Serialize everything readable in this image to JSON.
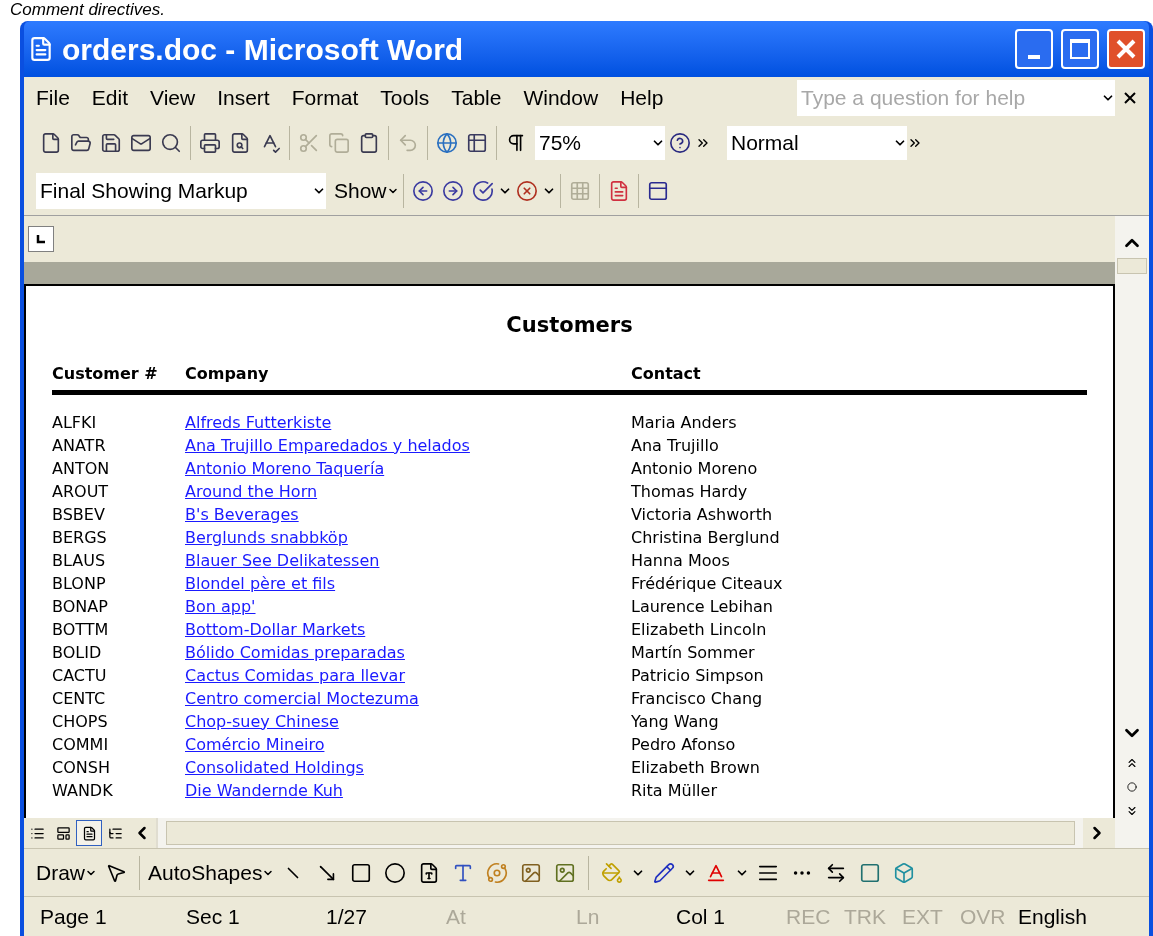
{
  "caption": "Comment directives.",
  "window": {
    "title": "orders.doc - Microsoft Word"
  },
  "menu": [
    "File",
    "Edit",
    "View",
    "Insert",
    "Format",
    "Tools",
    "Table",
    "Window",
    "Help"
  ],
  "help_box": {
    "placeholder": "Type a question for help"
  },
  "standard_toolbar": [
    {
      "disabled": false
    },
    {
      "disabled": false
    },
    {
      "disabled": false
    },
    {
      "disabled": false
    },
    {
      "disabled": false
    },
    {
      "disabled": false
    },
    {
      "disabled": false
    },
    {
      "disabled": false
    },
    {
      "disabled": true
    },
    {
      "disabled": true
    },
    {
      "disabled": false
    },
    {
      "disabled": true
    }
  ],
  "zoom": "75%",
  "style": "Normal",
  "display_mode": "Final Showing Markup",
  "show_menu": "Show",
  "document": {
    "heading": "Customers",
    "columns": [
      "Customer #",
      "Company",
      "Contact"
    ],
    "rows": [
      {
        "id": "ALFKI",
        "company": "Alfreds Futterkiste",
        "contact": "Maria Anders"
      },
      {
        "id": "ANATR",
        "company": "Ana Trujillo Emparedados y helados",
        "contact": "Ana Trujillo"
      },
      {
        "id": "ANTON",
        "company": "Antonio Moreno Taquería",
        "contact": "Antonio Moreno"
      },
      {
        "id": "AROUT",
        "company": "Around the Horn",
        "contact": "Thomas Hardy"
      },
      {
        "id": "BSBEV",
        "company": "B's Beverages",
        "contact": "Victoria Ashworth"
      },
      {
        "id": "BERGS",
        "company": "Berglunds snabbköp",
        "contact": "Christina Berglund"
      },
      {
        "id": "BLAUS",
        "company": "Blauer See Delikatessen",
        "contact": "Hanna Moos"
      },
      {
        "id": "BLONP",
        "company": "Blondel père et fils",
        "contact": "Frédérique Citeaux"
      },
      {
        "id": "BONAP",
        "company": "Bon app'",
        "contact": "Laurence Lebihan"
      },
      {
        "id": "BOTTM",
        "company": "Bottom-Dollar Markets",
        "contact": "Elizabeth Lincoln"
      },
      {
        "id": "BOLID",
        "company": "Bólido Comidas preparadas",
        "contact": "Martín Sommer"
      },
      {
        "id": "CACTU",
        "company": "Cactus Comidas para llevar",
        "contact": "Patricio Simpson"
      },
      {
        "id": "CENTC",
        "company": "Centro comercial Moctezuma",
        "contact": "Francisco Chang"
      },
      {
        "id": "CHOPS",
        "company": "Chop-suey Chinese",
        "contact": "Yang Wang"
      },
      {
        "id": "COMMI",
        "company": "Comércio Mineiro",
        "contact": "Pedro Afonso"
      },
      {
        "id": "CONSH",
        "company": "Consolidated Holdings",
        "contact": "Elizabeth Brown"
      },
      {
        "id": "WANDK",
        "company": "Die Wandernde Kuh",
        "contact": "Rita Müller"
      }
    ]
  },
  "view_buttons": [
    {
      "selected": false
    },
    {
      "selected": false
    },
    {
      "selected": true
    },
    {
      "selected": false
    }
  ],
  "drawing_toolbar": {
    "draw": "Draw",
    "autoshapes": "AutoShapes"
  },
  "status_bar": [
    {
      "text": "Page 1",
      "disabled": false
    },
    {
      "text": "Sec 1",
      "disabled": false
    },
    {
      "text": "1/27",
      "disabled": false
    },
    {
      "text": "At",
      "disabled": true
    },
    {
      "text": "Ln",
      "disabled": true
    },
    {
      "text": "Col 1",
      "disabled": false
    },
    {
      "text": "REC",
      "disabled": true
    },
    {
      "text": "TRK",
      "disabled": true
    },
    {
      "text": "EXT",
      "disabled": true
    },
    {
      "text": "OVR",
      "disabled": true
    },
    {
      "text": "English",
      "disabled": false
    }
  ]
}
